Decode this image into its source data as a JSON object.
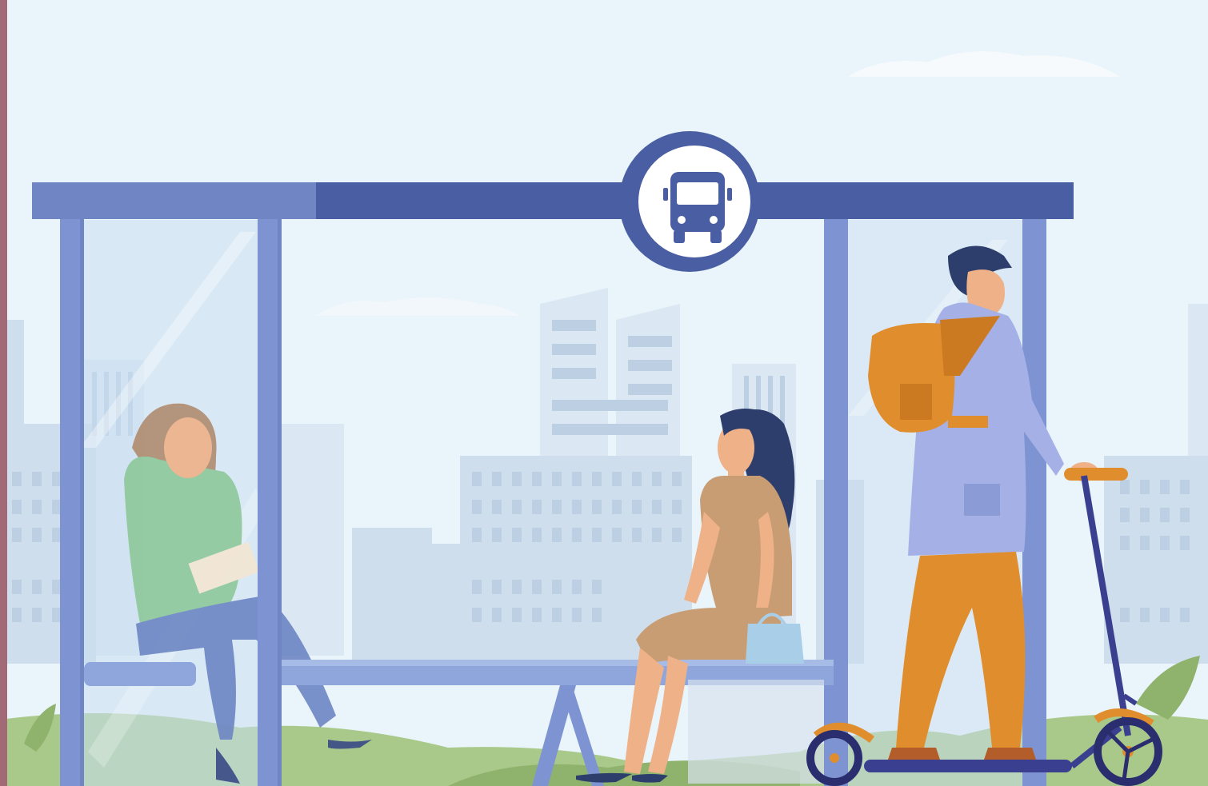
{
  "scene": {
    "description_label": "",
    "colors": {
      "sky": "#eaf4fb",
      "skyline_far": "#dbe8f3",
      "skyline_near": "#cddbea",
      "window": "#bfd0e3",
      "shelter_roof": "#4a5ea3",
      "shelter_roof_light": "#6f85c4",
      "shelter_post": "#7d93d2",
      "glass": "#c9def0",
      "bench": "#8ea6dc",
      "grass": "#a9c98a",
      "grass_dark": "#8fb36d",
      "left_border": "#a26a77",
      "sign_ring": "#4a5ea3",
      "sign_bg": "#ffffff",
      "skin": "#efb188",
      "orange": "#e08e2d",
      "navy": "#2d3e6c",
      "lavender": "#a5b1e6",
      "tan": "#c89d73",
      "green_shirt": "#8dc89a"
    },
    "icons": [
      "bus-icon"
    ]
  }
}
